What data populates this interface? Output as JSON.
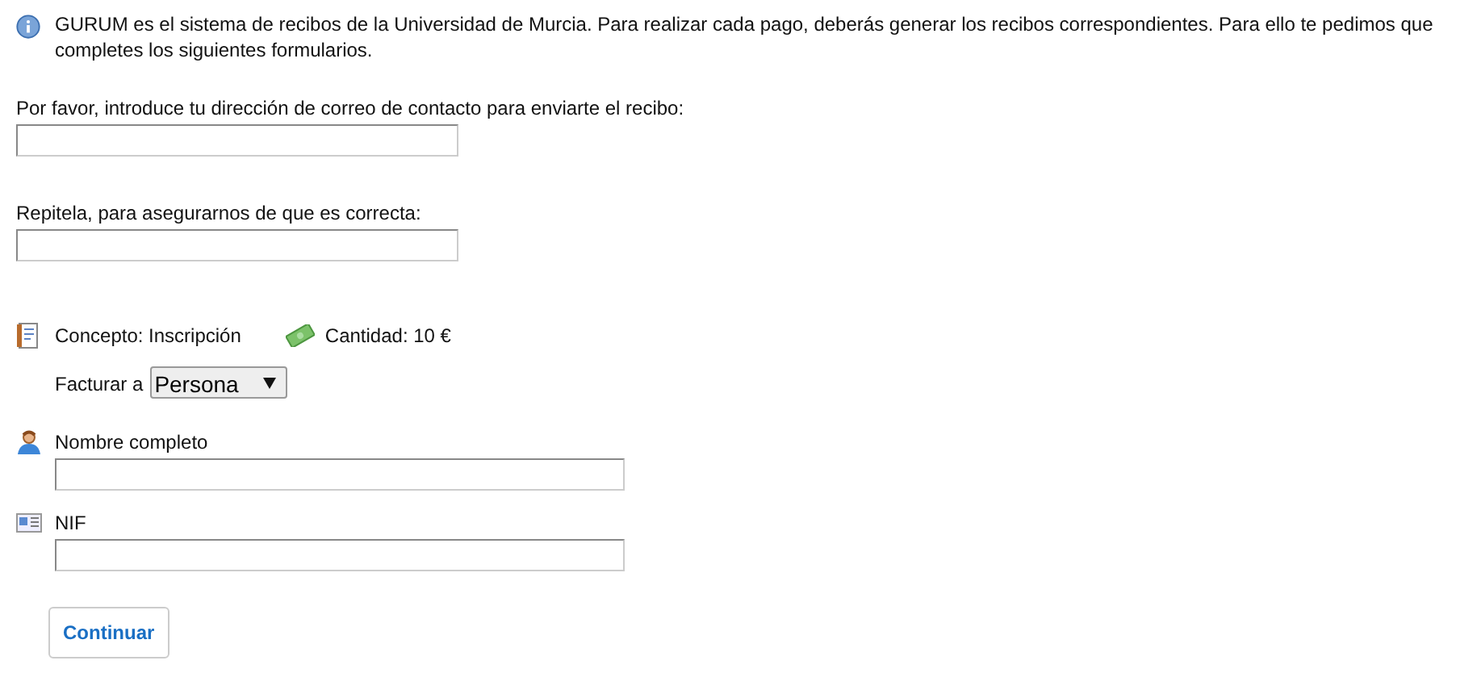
{
  "intro": "GURUM es el sistema de recibos de la Universidad de Murcia. Para realizar cada pago, deberás generar los recibos correspondientes. Para ello te pedimos que completes los siguientes formularios.",
  "email_fields": [
    {
      "label": "Por favor, introduce tu dirección de correo de contacto para enviarte el recibo:"
    },
    {
      "label": "Repitela, para asegurarnos de que es correcta:"
    }
  ],
  "concept": "Concepto: Inscripción",
  "amount": "Cantidad: 10 €",
  "bill_to": {
    "label": "Facturar a",
    "value": "Persona"
  },
  "person_fields": [
    {
      "kind": "person",
      "label": "Nombre completo"
    },
    {
      "kind": "id",
      "label": "NIF"
    }
  ],
  "button": "Continuar"
}
